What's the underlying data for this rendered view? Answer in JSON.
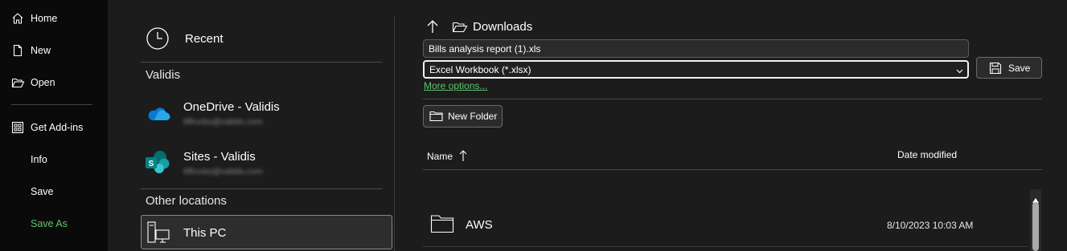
{
  "nav": {
    "items": [
      {
        "label": "Home",
        "icon": "home-icon"
      },
      {
        "label": "New",
        "icon": "new-document-icon"
      },
      {
        "label": "Open",
        "icon": "open-folder-icon"
      },
      {
        "label": "Get Add-ins",
        "icon": "add-ins-grid-icon"
      },
      {
        "label": "Info"
      },
      {
        "label": "Save"
      },
      {
        "label": "Save As",
        "active": true
      }
    ],
    "active_color": "#5fc46e"
  },
  "locations": {
    "recent_label": "Recent",
    "group_label": "Validis",
    "onedrive": {
      "title": "OneDrive - Validis",
      "subtitle": "tiffrocks@validis.com"
    },
    "sites": {
      "title": "Sites - Validis",
      "subtitle": "tiffrocks@validis.com"
    },
    "other_label": "Other locations",
    "this_pc_label": "This PC"
  },
  "save": {
    "folder_name": "Downloads",
    "filename": "Bills analysis report (1).xls",
    "file_type": "Excel Workbook (*.xlsx)",
    "more_options": "More options...",
    "save_label": "Save",
    "new_folder_label": "New Folder"
  },
  "file_list": {
    "col_name": "Name",
    "col_date": "Date modified",
    "rows": [
      {
        "name": "AWS",
        "date": "8/10/2023 10:03 AM"
      }
    ]
  }
}
